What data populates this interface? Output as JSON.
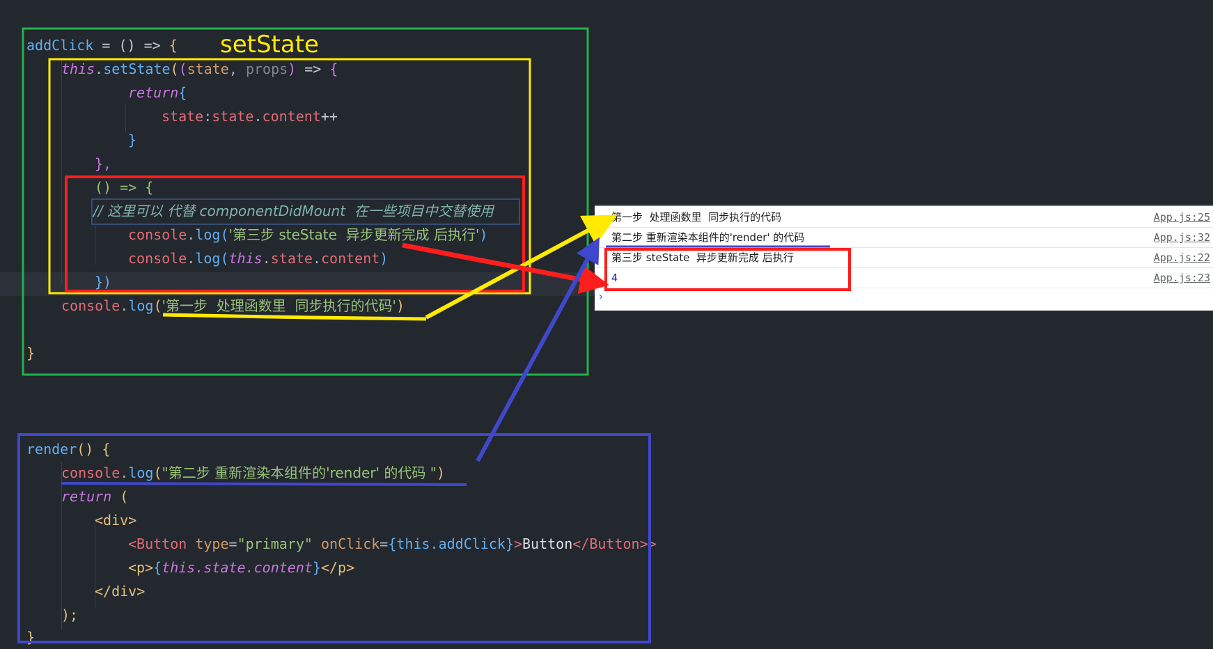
{
  "overlay_label": "setState",
  "code": {
    "add_click_name": "addClick",
    "arrow_decl": " = () => ",
    "open_brace": "{",
    "this_kw": "this",
    "set_state": "setState",
    "params_state": "state",
    "params_props": "props",
    "arrow": " => ",
    "return_kw": "return",
    "state_key": "state",
    "state_obj": "state",
    "content_prop": "content",
    "incr": "++",
    "close_brace": "}",
    "close_brace_comma": "},",
    "callback_open": "() => {",
    "comment": "// 这里可以 代替 componentDidMount  在一些项目中交替使用",
    "console": "console",
    "log": "log",
    "log_str_3": "'第三步 steState  异步更新完成 后执行'",
    "log_this_state_content": "this.state.content",
    "callback_close": "})",
    "log_str_1": "'第一步  处理函数里  同步执行的代码'",
    "render_name": "render",
    "render_sig": "() {",
    "log_str_2": "\"第二步 重新渲染本组件的'render' 的代码 \"",
    "return_paren": "(",
    "div_open": "<div>",
    "button_open": "Button",
    "attr_type": "type",
    "attr_type_val": "\"primary\"",
    "attr_onclick": "onClick",
    "onclick_expr": "this.addClick",
    "button_text": "Button",
    "button_close": "</Button>",
    "p_expr": "this.state.content",
    "div_close": "</div>",
    "return_close": ");",
    "final_brace": "}"
  },
  "console_panel": {
    "rows": [
      {
        "message": "第一步  处理函数里  同步执行的代码",
        "source": "App.js:25"
      },
      {
        "message": "第二步 重新渲染本组件的'render' 的代码",
        "source": "App.js:32"
      },
      {
        "message": "第三步 steState  异步更新完成 后执行",
        "source": "App.js:22"
      },
      {
        "message": "4",
        "source": "App.js:23"
      }
    ],
    "prompt": "›"
  },
  "colors": {
    "background": "#23272e",
    "green_box": "#22b24c",
    "yellow_box": "#ffea00",
    "red_box": "#ff1e1e",
    "blue_box": "#3f48cc"
  }
}
